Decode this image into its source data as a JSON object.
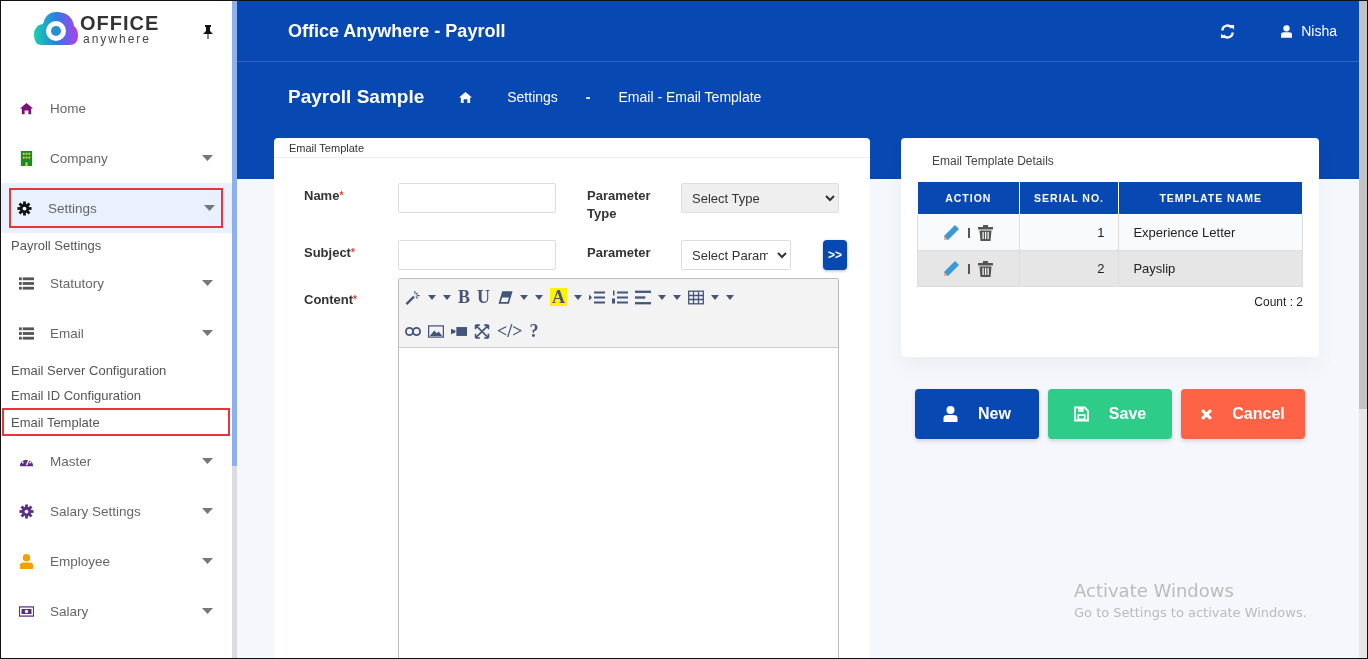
{
  "sidebar": {
    "logo": {
      "line1": "OFFICE",
      "line2": "anywhere"
    },
    "items": [
      {
        "label": "Home",
        "expandable": false,
        "selected": false
      },
      {
        "label": "Company",
        "expandable": true,
        "selected": false
      },
      {
        "label": "Settings",
        "expandable": true,
        "selected": true,
        "children": [
          {
            "label": "Payroll Settings",
            "selected": false
          }
        ]
      },
      {
        "label": "Statutory",
        "expandable": true,
        "selected": false
      },
      {
        "label": "Email",
        "expandable": true,
        "selected": false,
        "children": [
          {
            "label": "Email Server Configuration",
            "selected": false
          },
          {
            "label": "Email ID Configuration",
            "selected": false
          },
          {
            "label": "Email Template",
            "selected": true
          }
        ]
      },
      {
        "label": "Master",
        "expandable": true,
        "selected": false
      },
      {
        "label": "Salary Settings",
        "expandable": true,
        "selected": false
      },
      {
        "label": "Employee",
        "expandable": true,
        "selected": false
      },
      {
        "label": "Salary",
        "expandable": true,
        "selected": false
      }
    ]
  },
  "header": {
    "title": "Office Anywhere - Payroll",
    "user": "Nisha"
  },
  "breadcrumb": {
    "title": "Payroll Sample",
    "crumbs": [
      "Settings",
      "-",
      "Email - Email Template"
    ]
  },
  "form_card": {
    "title": "Email Template",
    "fields": [
      {
        "label": "Name",
        "mark": "*"
      },
      {
        "label": "Subject",
        "mark": "*"
      }
    ],
    "selects": [
      {
        "label": "Parameter Type",
        "value": "Select Type",
        "disabled": true
      },
      {
        "label": "Parameter",
        "value": "Select Param",
        "disabled": false
      }
    ],
    "insert_button": ">>",
    "content_label": {
      "label": "Content",
      "mark": "*"
    },
    "toolbar": [
      [
        {
          "kind": "wand"
        },
        {
          "kind": "caret"
        },
        {
          "kind": "caret"
        },
        {
          "kind": "text",
          "label": "B"
        },
        {
          "kind": "text",
          "label": "U"
        },
        {
          "kind": "eraser"
        },
        {
          "kind": "caret"
        },
        {
          "kind": "caret"
        },
        {
          "kind": "highlight",
          "label": "A"
        },
        {
          "kind": "caret"
        },
        {
          "kind": "bullets"
        },
        {
          "kind": "numbers"
        },
        {
          "kind": "align"
        },
        {
          "kind": "caret"
        },
        {
          "kind": "caret"
        },
        {
          "kind": "table"
        },
        {
          "kind": "caret"
        },
        {
          "kind": "caret"
        }
      ],
      [
        {
          "kind": "link"
        },
        {
          "kind": "image"
        },
        {
          "kind": "video"
        },
        {
          "kind": "expand"
        },
        {
          "kind": "text",
          "label": "</>"
        },
        {
          "kind": "text",
          "label": "?"
        }
      ]
    ]
  },
  "details_card": {
    "title": "Email Template Details",
    "table": {
      "columns": [
        "ACTION",
        "SERIAL NO.",
        "TEMPLATE NAME"
      ],
      "rows": [
        {
          "serial": "1",
          "name": "Experience Letter"
        },
        {
          "serial": "2",
          "name": "Payslip"
        }
      ]
    },
    "count": "Count : 2"
  },
  "buttons": [
    {
      "kind": "new",
      "label": "New"
    },
    {
      "kind": "save",
      "label": "Save"
    },
    {
      "kind": "cancel",
      "label": "Cancel"
    }
  ],
  "activation_notice": {
    "title": "Activate Windows",
    "text": "Go to Settings to activate Windows."
  }
}
